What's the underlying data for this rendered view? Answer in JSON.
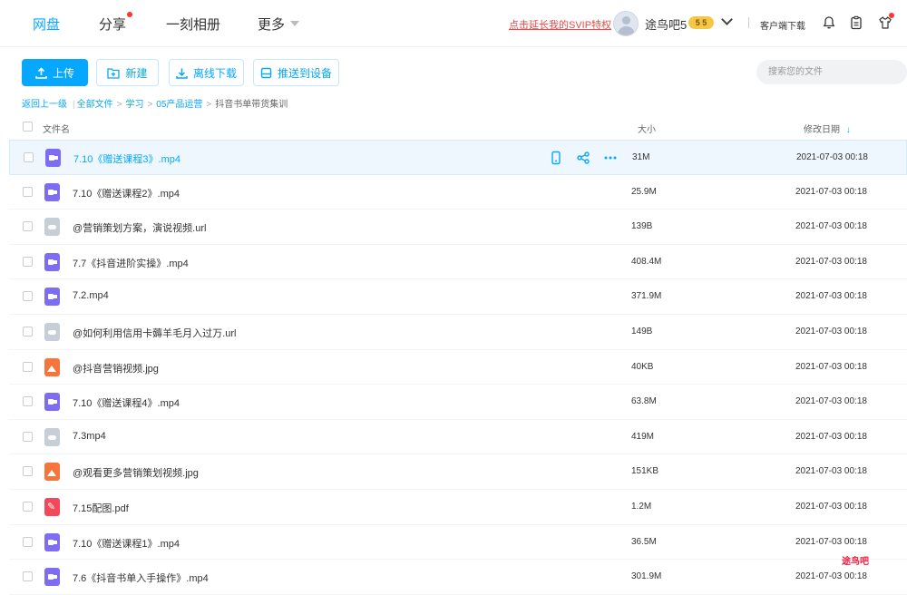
{
  "nav": {
    "items": [
      {
        "label": "网盘",
        "active": true
      },
      {
        "label": "分享",
        "dot": true
      },
      {
        "label": "一刻相册"
      },
      {
        "label": "更多"
      }
    ]
  },
  "header": {
    "promo_link": "点击延长我的SVIP特权",
    "username": "途鸟吧5",
    "vip_badge": "5 5",
    "client_download": "客户端下载"
  },
  "toolbar": {
    "upload": "上传",
    "new": "新建",
    "offline": "离线下载",
    "push": "推送到设备",
    "search_placeholder": "搜索您的文件"
  },
  "breadcrumb": {
    "back": "返回上一级",
    "all": "全部文件",
    "items": [
      "学习",
      "05产品运营"
    ],
    "current": "抖音书单带货集训"
  },
  "columns": {
    "name": "文件名",
    "size": "大小",
    "date": "修改日期"
  },
  "files": [
    {
      "name": "7.10《赠送课程3》.mp4",
      "size": "31M",
      "date": "2021-07-03 00:18",
      "type": "video",
      "selected": true
    },
    {
      "name": "7.10《赠送课程2》.mp4",
      "size": "25.9M",
      "date": "2021-07-03 00:18",
      "type": "video"
    },
    {
      "name": "@营销策划方案，演说视频.url",
      "size": "139B",
      "date": "2021-07-03 00:18",
      "type": "link"
    },
    {
      "name": "7.7《抖音进阶实操》.mp4",
      "size": "408.4M",
      "date": "2021-07-03 00:18",
      "type": "video"
    },
    {
      "name": "7.2.mp4",
      "size": "371.9M",
      "date": "2021-07-03 00:18",
      "type": "video"
    },
    {
      "name": "@如何利用信用卡薅羊毛月入过万.url",
      "size": "149B",
      "date": "2021-07-03 00:18",
      "type": "link"
    },
    {
      "name": "@抖音营销视频.jpg",
      "size": "40KB",
      "date": "2021-07-03 00:18",
      "type": "image"
    },
    {
      "name": "7.10《赠送课程4》.mp4",
      "size": "63.8M",
      "date": "2021-07-03 00:18",
      "type": "video"
    },
    {
      "name": "7.3mp4",
      "size": "419M",
      "date": "2021-07-03 00:18",
      "type": "link"
    },
    {
      "name": "@观看更多营销策划视频.jpg",
      "size": "151KB",
      "date": "2021-07-03 00:18",
      "type": "image"
    },
    {
      "name": "7.15配图.pdf",
      "size": "1.2M",
      "date": "2021-07-03 00:18",
      "type": "pdf"
    },
    {
      "name": "7.10《赠送课程1》.mp4",
      "size": "36.5M",
      "date": "2021-07-03 00:18",
      "type": "video"
    },
    {
      "name": "7.6《抖音书单入手操作》.mp4",
      "size": "301.9M",
      "date": "2021-07-03 00:18",
      "type": "video"
    }
  ],
  "watermark": "途鸟吧",
  "colors": {
    "accent": "#06a7ff",
    "promo": "#e84a4a"
  }
}
